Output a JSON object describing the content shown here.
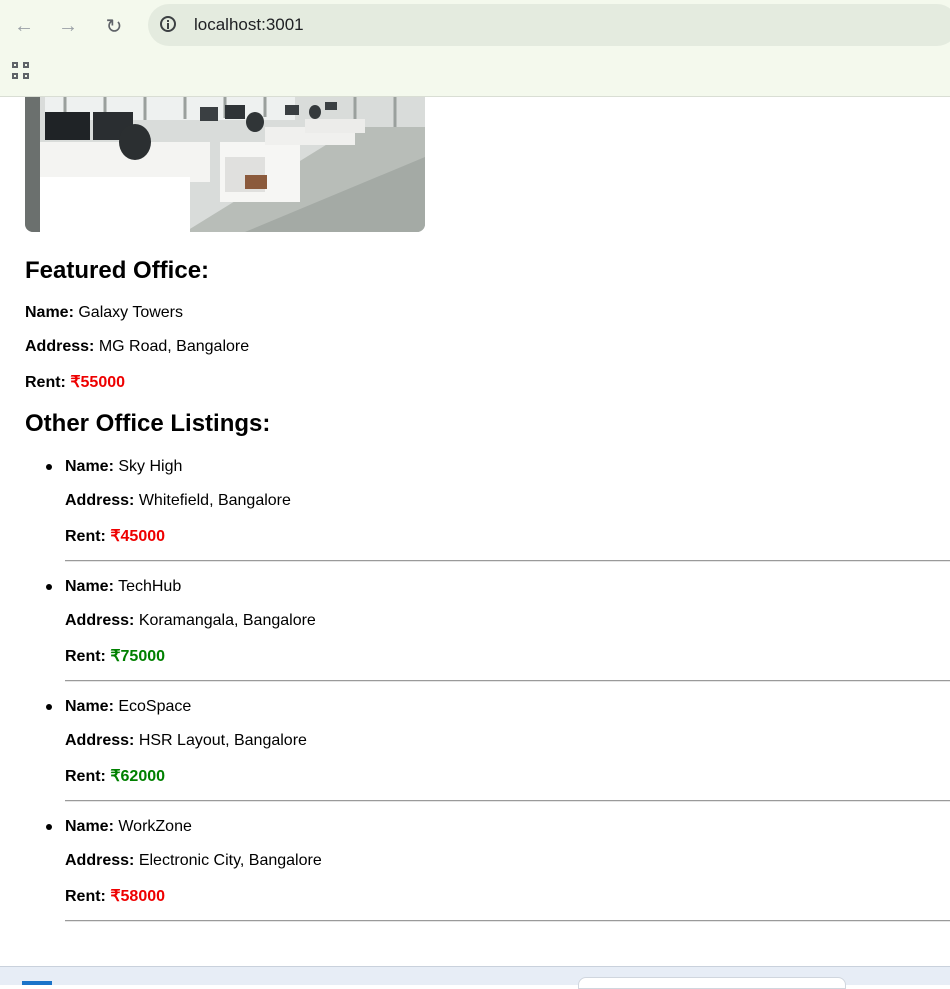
{
  "browser": {
    "url": "localhost:3001"
  },
  "featured": {
    "heading": "Featured Office:",
    "name_label": "Name:",
    "name": "Galaxy Towers",
    "address_label": "Address:",
    "address": "MG Road, Bangalore",
    "rent_label": "Rent:",
    "rent": "₹55000"
  },
  "others": {
    "heading": "Other Office Listings:",
    "items": [
      {
        "name_label": "Name:",
        "name": "Sky High",
        "address_label": "Address:",
        "address": "Whitefield, Bangalore",
        "rent_label": "Rent:",
        "rent": "₹45000",
        "rent_color": "#ee0000"
      },
      {
        "name_label": "Name:",
        "name": "TechHub",
        "address_label": "Address:",
        "address": "Koramangala, Bangalore",
        "rent_label": "Rent:",
        "rent": "₹75000",
        "rent_color": "#008000"
      },
      {
        "name_label": "Name:",
        "name": "EcoSpace",
        "address_label": "Address:",
        "address": "HSR Layout, Bangalore",
        "rent_label": "Rent:",
        "rent": "₹62000",
        "rent_color": "#008000"
      },
      {
        "name_label": "Name:",
        "name": "WorkZone",
        "address_label": "Address:",
        "address": "Electronic City, Bangalore",
        "rent_label": "Rent:",
        "rent": "₹58000",
        "rent_color": "#ee0000"
      }
    ]
  }
}
